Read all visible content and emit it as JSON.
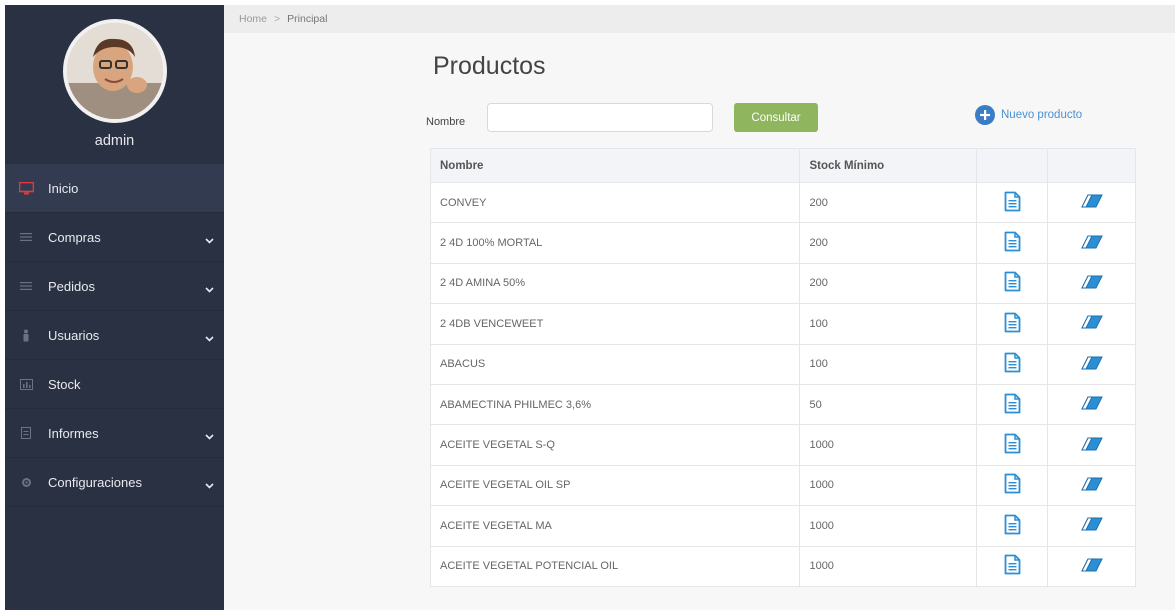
{
  "user": {
    "name": "admin"
  },
  "breadcrumb": {
    "home": "Home",
    "separator": ">",
    "current": "Principal"
  },
  "sidebar": {
    "items": [
      {
        "label": "Inicio",
        "icon": "monitor-icon",
        "active": true,
        "has_submenu": false
      },
      {
        "label": "Compras",
        "icon": "list-icon",
        "active": false,
        "has_submenu": true
      },
      {
        "label": "Pedidos",
        "icon": "list-icon",
        "active": false,
        "has_submenu": true
      },
      {
        "label": "Usuarios",
        "icon": "user-icon",
        "active": false,
        "has_submenu": true
      },
      {
        "label": "Stock",
        "icon": "chart-icon",
        "active": false,
        "has_submenu": false
      },
      {
        "label": "Informes",
        "icon": "document-icon",
        "active": false,
        "has_submenu": true
      },
      {
        "label": "Configuraciones",
        "icon": "gear-icon",
        "active": false,
        "has_submenu": true
      }
    ]
  },
  "page": {
    "title": "Productos",
    "filter": {
      "label": "Nombre",
      "value": "",
      "placeholder": ""
    },
    "consultar_label": "Consultar",
    "new_product_label": "Nuevo producto"
  },
  "table": {
    "columns": [
      "Nombre",
      "Stock Mínimo",
      "",
      ""
    ],
    "rows": [
      {
        "nombre": "CONVEY",
        "stock_minimo": "200"
      },
      {
        "nombre": "2 4D 100% MORTAL",
        "stock_minimo": "200"
      },
      {
        "nombre": "2 4D AMINA 50%",
        "stock_minimo": "200"
      },
      {
        "nombre": "2 4DB VENCEWEET",
        "stock_minimo": "100"
      },
      {
        "nombre": "ABACUS",
        "stock_minimo": "100"
      },
      {
        "nombre": "ABAMECTINA PHILMEC 3,6%",
        "stock_minimo": "50"
      },
      {
        "nombre": "ACEITE VEGETAL S-Q",
        "stock_minimo": "1000"
      },
      {
        "nombre": "ACEITE VEGETAL OIL SP",
        "stock_minimo": "1000"
      },
      {
        "nombre": "ACEITE VEGETAL MA",
        "stock_minimo": "1000"
      },
      {
        "nombre": "ACEITE VEGETAL POTENCIAL OIL",
        "stock_minimo": "1000"
      }
    ]
  },
  "colors": {
    "sidebar_bg": "#2a3142",
    "sidebar_active": "#323b50",
    "accent_red": "#e8383d",
    "button_green": "#8fb55f",
    "link_blue": "#4a91d6",
    "icon_blue": "#2a8fd4"
  }
}
